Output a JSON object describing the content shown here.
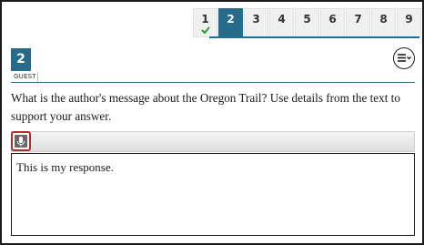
{
  "nav": {
    "tabs": [
      {
        "label": "1",
        "answered": true
      },
      {
        "label": "2",
        "active": true
      },
      {
        "label": "3"
      },
      {
        "label": "4"
      },
      {
        "label": "5"
      },
      {
        "label": "6"
      },
      {
        "label": "7"
      },
      {
        "label": "8"
      },
      {
        "label": "9"
      }
    ]
  },
  "question": {
    "number": "2",
    "role": "GUEST",
    "text": "What is the author's message about the Oregon Trail? Use details from the text to support your answer."
  },
  "response": {
    "value": "This is my response."
  },
  "colors": {
    "accent": "#266b8a",
    "mic_border": "#b02d2d",
    "check": "#2e9a3a"
  },
  "icons": {
    "menu": "options-menu-icon",
    "mic": "microphone-icon",
    "check": "checkmark-icon"
  }
}
